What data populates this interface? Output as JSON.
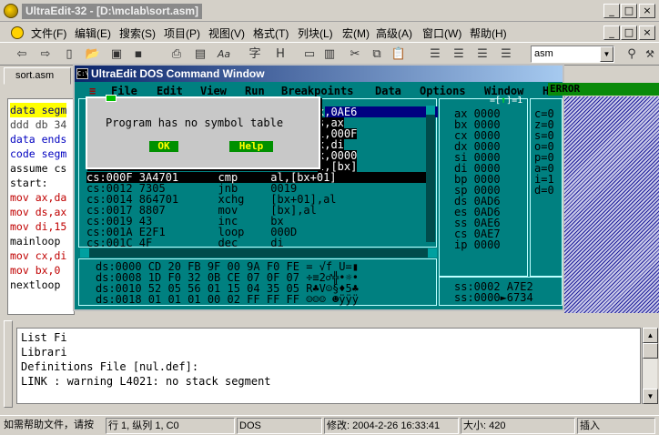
{
  "window": {
    "title": "UltraEdit-32 - [D:\\mclab\\sort.asm]",
    "min": "_",
    "max": "□",
    "close": "×"
  },
  "menu": [
    {
      "label": "文件(F)"
    },
    {
      "label": "编辑(E)"
    },
    {
      "label": "搜索(S)"
    },
    {
      "label": "项目(P)"
    },
    {
      "label": "视图(V)"
    },
    {
      "label": "格式(T)"
    },
    {
      "label": "列块(L)"
    },
    {
      "label": "宏(M)"
    },
    {
      "label": "高级(A)"
    },
    {
      "label": "窗口(W)"
    },
    {
      "label": "帮助(H)"
    }
  ],
  "mdi": {
    "min": "_",
    "max": "□",
    "close": "×"
  },
  "toolbar": {
    "combo_value": "asm"
  },
  "tab": {
    "label": "sort.asm"
  },
  "editor_lines": [
    "data segm",
    "ddd db 34",
    "data ends",
    "code segm",
    "assume cs",
    "start:",
    "mov ax,da",
    "mov ds,ax",
    "mov di,15",
    "mainloop",
    "mov cx,di",
    "mov bx,0",
    "nextloop"
  ],
  "dos": {
    "title": "UltraEdit DOS Command Window",
    "menu": [
      "File",
      "Edit",
      "View",
      "Run",
      "Breakpoints",
      "Data",
      "Options",
      "Window",
      "Help"
    ],
    "error_badge": "ERROR",
    "code_lines_top": [
      "x,0AE6",
      "s,ax",
      "i,000F",
      "x,di",
      "x,0000",
      "l,[bx]"
    ],
    "code_lines": [
      "cs:000F 3A4701      cmp     al,[bx+01]",
      "cs:0012 7305        jnb     0019",
      "cs:0014 864701      xchg    [bx+01],al",
      "cs:0017 8807        mov     [bx],al",
      "cs:0019 43          inc     bx",
      "cs:001A E2F1        loop    000D",
      "cs:001C 4F          dec     di"
    ],
    "dump_lines": [
      "ds:0000 CD 20 FB 9F 00 9A F0 FE = √f U=▮",
      "ds:0008 1D F0 32 0B CE 07 0F 07 ÷≡2♂╬•☼•",
      "ds:0010 52 05 56 01 15 04 35 05 R♣V☺§♦5♣",
      "ds:0018 01 01 01 00 02 FF FF FF ☺☺☺ ☻ÿÿÿ"
    ],
    "registers": [
      "ax 0000",
      "bx 0000",
      "cx 0000",
      "dx 0000",
      "si 0000",
      "di 0000",
      "bp 0000",
      "sp 0000",
      "ds 0AD6",
      "es 0AD6",
      "ss 0AE6",
      "cs 0AE7",
      "ip 0000"
    ],
    "flags": [
      "c=0",
      "z=0",
      "s=0",
      "o=0",
      "p=0",
      "a=0",
      "i=1",
      "d=0"
    ],
    "stack": [
      "ss:0002 A7E2",
      "ss:0000►6734"
    ],
    "panel_marker": "1",
    "dialog": {
      "message": "Program has no symbol table",
      "ok": "OK",
      "help": "Help"
    }
  },
  "output_lines": [
    "List Fi",
    "Librari",
    "Definitions File [nul.def]:",
    "LINK : warning L4021: no stack segment"
  ],
  "status": {
    "help": "如需帮助文件，请按",
    "position": "行 1, 纵列 1, C0",
    "mode": "DOS",
    "modified": "修改: 2004-2-26 16:33:41",
    "size": "大小: 420",
    "insert": "插入"
  }
}
